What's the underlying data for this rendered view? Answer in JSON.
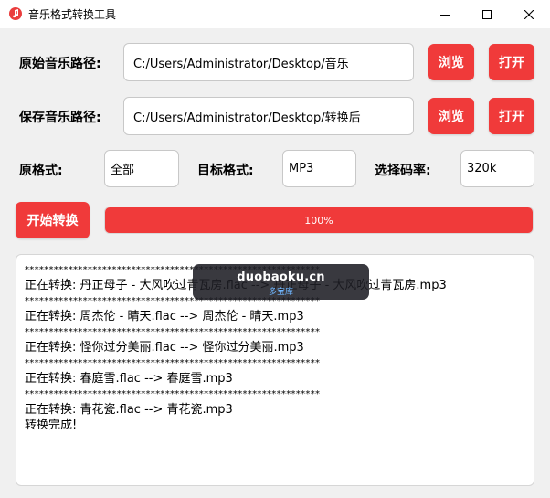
{
  "window": {
    "title": "音乐格式转换工具",
    "icon": "music-note-icon"
  },
  "source": {
    "label": "原始音乐路径:",
    "value": "C:/Users/Administrator/Desktop/音乐",
    "browse_label": "浏览",
    "open_label": "打开"
  },
  "save": {
    "label": "保存音乐路径:",
    "value": "C:/Users/Administrator/Desktop/转换后",
    "browse_label": "浏览",
    "open_label": "打开"
  },
  "options": {
    "source_format_label": "原格式:",
    "source_format_value": "全部",
    "target_format_label": "目标格式:",
    "target_format_value": "MP3",
    "bitrate_label": "选择码率:",
    "bitrate_value": "320k"
  },
  "action": {
    "start_label": "开始转换",
    "progress_text": "100%",
    "progress_fraction": 1.0
  },
  "log": {
    "lines": [
      {
        "text": "*************************************************************",
        "sep": true
      },
      {
        "text": "正在转换: 丹正母子 - 大风吹过青瓦房.flac --> 丹正母子 - 大风吹过青瓦房.mp3",
        "sep": false
      },
      {
        "text": "*************************************************************",
        "sep": true
      },
      {
        "text": "正在转换: 周杰伦 - 晴天.flac --> 周杰伦 - 晴天.mp3",
        "sep": false
      },
      {
        "text": "*************************************************************",
        "sep": true
      },
      {
        "text": "正在转换: 怪你过分美丽.flac --> 怪你过分美丽.mp3",
        "sep": false
      },
      {
        "text": "*************************************************************",
        "sep": true
      },
      {
        "text": "正在转换: 春庭雪.flac --> 春庭雪.mp3",
        "sep": false
      },
      {
        "text": "*************************************************************",
        "sep": true
      },
      {
        "text": "正在转换: 青花瓷.flac --> 青花瓷.mp3",
        "sep": false
      },
      {
        "text": "转换完成!",
        "sep": false
      }
    ]
  },
  "watermark": {
    "main": "duobaoku.cn",
    "sub": "多宝库"
  },
  "colors": {
    "accent": "#f03a3a",
    "background": "#f0f0f0"
  }
}
